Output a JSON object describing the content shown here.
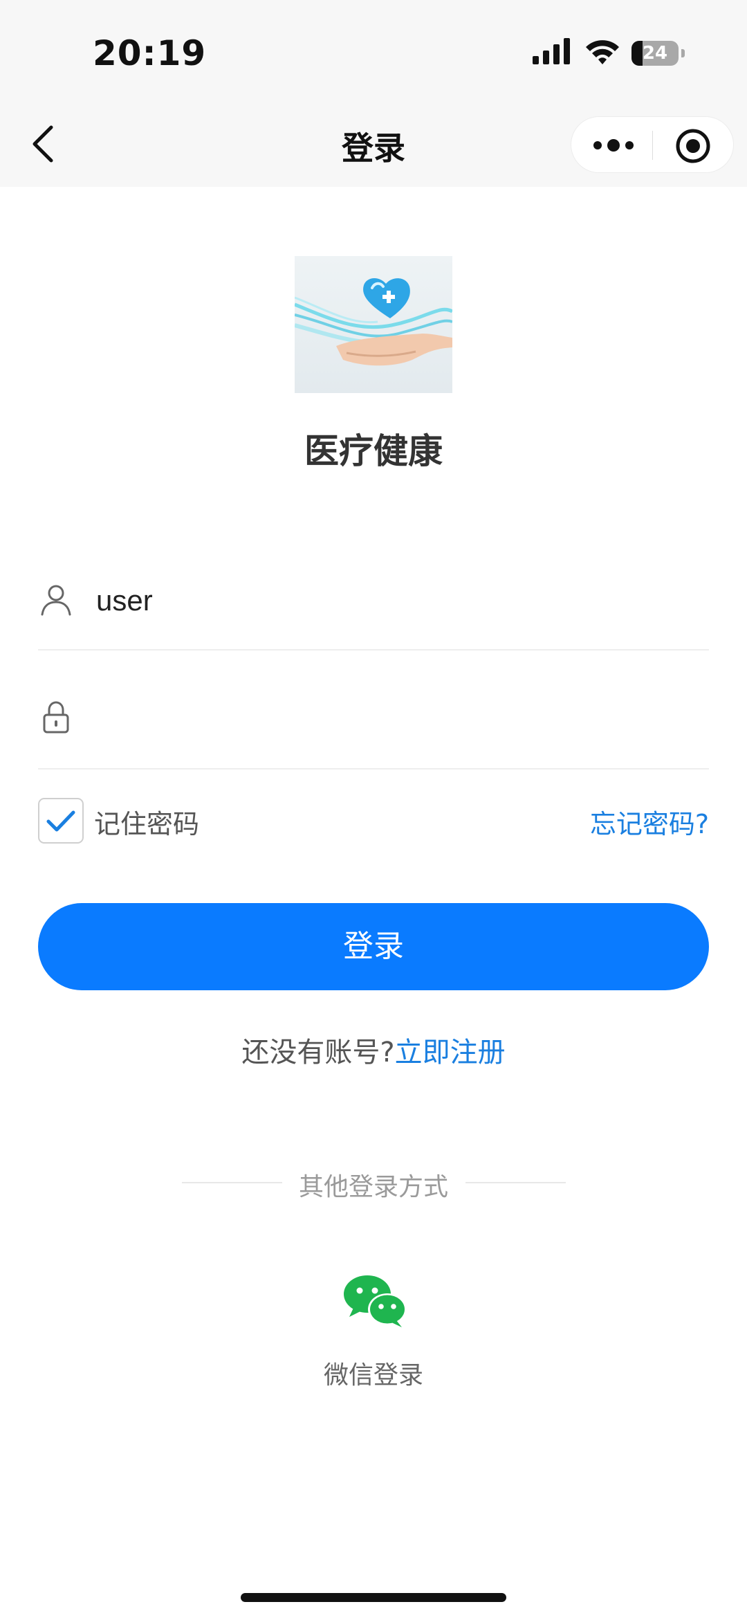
{
  "status_bar": {
    "time": "20:19",
    "battery": "24"
  },
  "nav": {
    "title": "登录"
  },
  "app": {
    "name": "医疗健康"
  },
  "form": {
    "username_value": "user",
    "password_value": "",
    "remember_label": "记住密码",
    "remember_checked": true,
    "forgot_label": "忘记密码?",
    "login_label": "登录",
    "no_account_text": "还没有账号?",
    "register_label": "立即注册"
  },
  "other_login": {
    "title": "其他登录方式",
    "wechat_label": "微信登录"
  },
  "colors": {
    "primary": "#0a7bff",
    "link": "#1a7fe0",
    "wechat": "#1fb54f"
  }
}
